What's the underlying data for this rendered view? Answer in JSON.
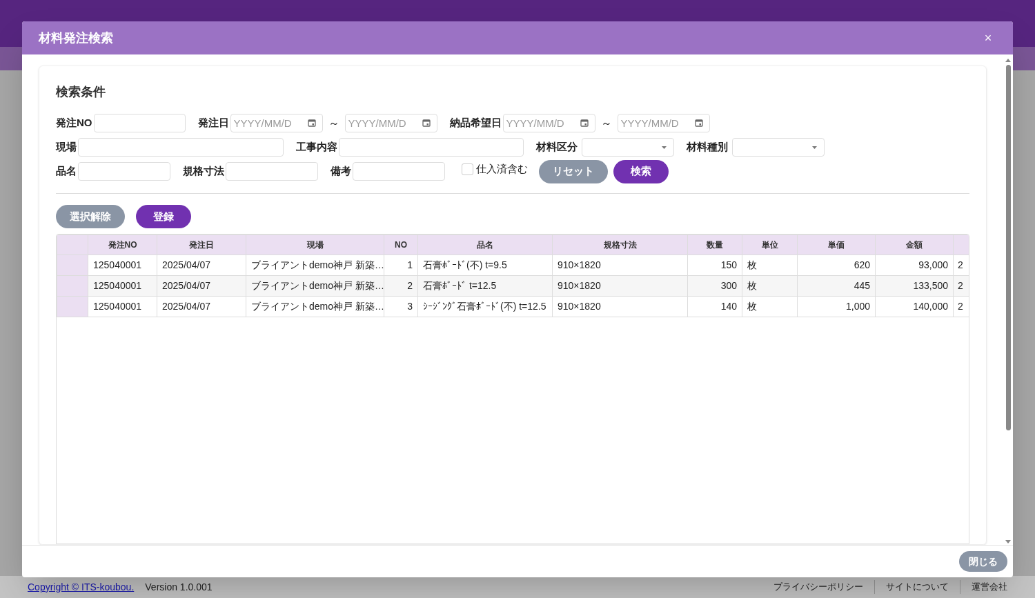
{
  "modal": {
    "title": "材料発注検索",
    "close_label": "×",
    "search": {
      "heading": "検索条件",
      "rows": [
        [
          {
            "kind": "text",
            "label": "発注NO"
          },
          {
            "kind": "date_range",
            "label": "発注日",
            "from": {
              "placeholder": "YYYY/MM/D"
            },
            "separator": "～",
            "to": {
              "placeholder": "YYYY/MM/D"
            }
          },
          {
            "kind": "date_range",
            "label": "納品希望日",
            "from": {
              "placeholder": "YYYY/MM/D"
            },
            "separator": "～",
            "to": {
              "placeholder": "YYYY/MM/D"
            }
          }
        ],
        [
          {
            "kind": "text",
            "label": "現場"
          },
          {
            "kind": "text",
            "label": "工事内容"
          },
          {
            "kind": "select",
            "label": "材料区分"
          },
          {
            "kind": "select",
            "label": "材料種別"
          }
        ],
        [
          {
            "kind": "text",
            "label": "品名"
          },
          {
            "kind": "text",
            "label": "規格寸法"
          },
          {
            "kind": "text",
            "label": "備考"
          },
          {
            "kind": "checkbox",
            "label": "仕入済含む",
            "checked": false
          }
        ]
      ],
      "buttons": [
        {
          "label": "リセット",
          "kind": "secondary"
        },
        {
          "label": "検索",
          "kind": "primary"
        }
      ]
    },
    "actions": [
      {
        "label": "選択解除",
        "kind": "secondary"
      },
      {
        "label": "登録",
        "kind": "primary"
      }
    ],
    "table": {
      "columns": [
        "発注NO",
        "発注日",
        "現場",
        "NO",
        "品名",
        "規格寸法",
        "数量",
        "単位",
        "単価",
        "金額",
        ""
      ],
      "rows": [
        {
          "selected": false,
          "cells": [
            "125040001",
            "2025/04/07",
            "ブライアントdemo神戸 新築…",
            "1",
            "石膏ﾎﾞｰﾄﾞ(不) t=9.5",
            "910×1820",
            "150",
            "枚",
            "620",
            "93,000",
            "2"
          ]
        },
        {
          "selected": false,
          "cells": [
            "125040001",
            "2025/04/07",
            "ブライアントdemo神戸 新築…",
            "2",
            "石膏ﾎﾞｰﾄﾞ t=12.5",
            "910×1820",
            "300",
            "枚",
            "445",
            "133,500",
            "2"
          ]
        },
        {
          "selected": false,
          "cells": [
            "125040001",
            "2025/04/07",
            "ブライアントdemo神戸 新築…",
            "3",
            "ｼｰｼﾞﾝｸﾞ石膏ﾎﾞｰﾄﾞ(不) t=12.5",
            "910×1820",
            "140",
            "枚",
            "1,000",
            "140,000",
            "2"
          ]
        }
      ]
    },
    "footer_button": "閉じる"
  },
  "page_footer": {
    "copyright": "Copyright © ITS-koubou.",
    "version": "Version 1.0.001",
    "links": [
      "プライバシーポリシー",
      "サイトについて",
      "運営会社"
    ]
  }
}
